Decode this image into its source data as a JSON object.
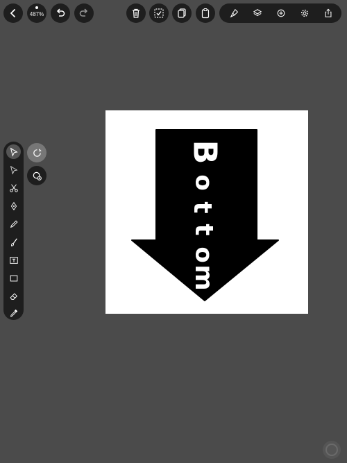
{
  "toolbar": {
    "zoom_label": "487%",
    "left_buttons": [
      {
        "icon": "chevron-left-icon"
      },
      {
        "icon": "zoom-indicator"
      },
      {
        "icon": "undo-icon"
      },
      {
        "icon": "redo-icon"
      }
    ],
    "center_buttons": [
      {
        "icon": "trash-icon"
      },
      {
        "icon": "select-all-icon"
      },
      {
        "icon": "duplicate-icon"
      },
      {
        "icon": "clipboard-icon"
      }
    ],
    "right_group": [
      {
        "icon": "stamp-icon"
      },
      {
        "icon": "layers-icon"
      },
      {
        "icon": "add-icon"
      },
      {
        "icon": "settings-icon"
      },
      {
        "icon": "share-icon"
      }
    ]
  },
  "tools": [
    {
      "name": "select-tool",
      "icon": "pointer-icon",
      "active": true
    },
    {
      "name": "direct-select-tool",
      "icon": "direct-pointer-icon"
    },
    {
      "name": "scissors-tool",
      "icon": "scissors-icon"
    },
    {
      "name": "pen-tool",
      "icon": "pen-nib-icon"
    },
    {
      "name": "pencil-tool",
      "icon": "pencil-icon"
    },
    {
      "name": "brush-tool",
      "icon": "brush-icon"
    },
    {
      "name": "text-tool",
      "icon": "text-box-icon"
    },
    {
      "name": "shape-tool",
      "icon": "rectangle-icon"
    },
    {
      "name": "eraser-tool",
      "icon": "eraser-icon"
    },
    {
      "name": "eyedropper-tool",
      "icon": "eyedropper-icon"
    }
  ],
  "sub_tools": [
    {
      "name": "freehand-select-option",
      "icon": "lasso-select-icon",
      "active": true
    },
    {
      "name": "lasso-add-option",
      "icon": "lasso-add-icon"
    }
  ],
  "artwork": {
    "text": "Bottom",
    "letters": [
      "B",
      "o",
      "t",
      "t",
      "o",
      "m"
    ],
    "fill": "#000000",
    "text_color": "#ffffff"
  },
  "colors": {
    "background": "#4b4b4b",
    "toolbar": "#1e1e1e",
    "canvas": "#ffffff"
  }
}
